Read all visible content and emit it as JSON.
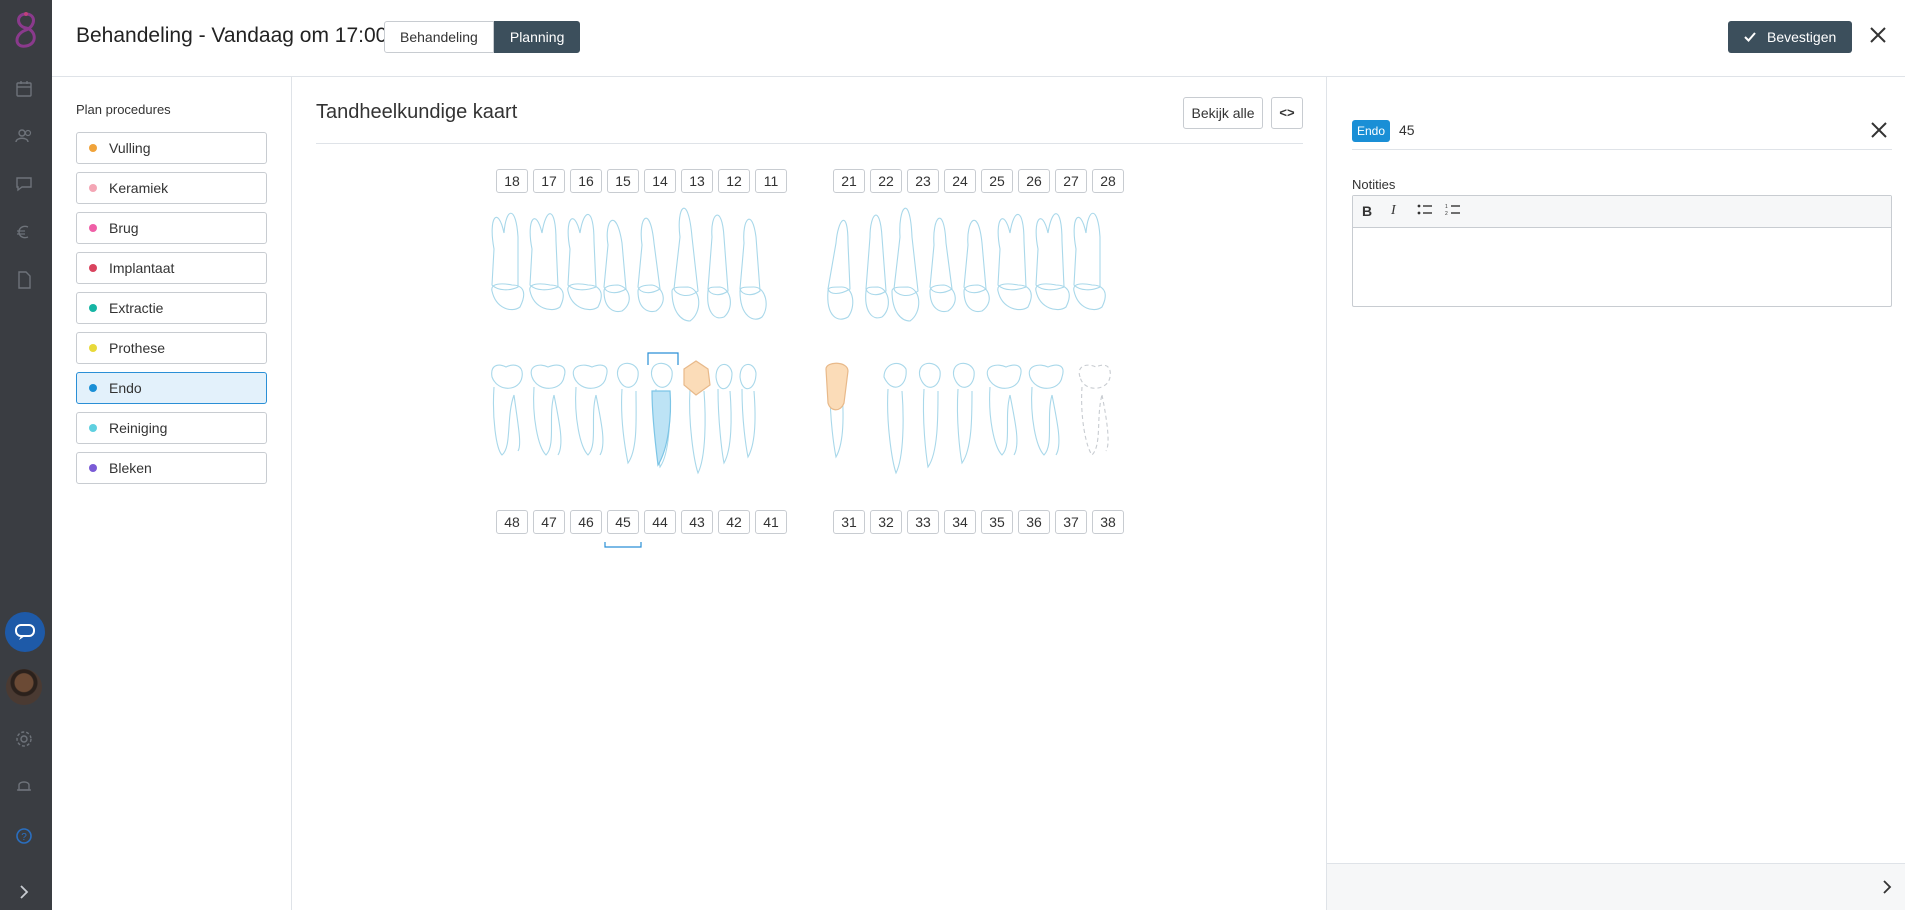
{
  "header": {
    "title": "Behandeling - Vandaag om 17:00",
    "tabs": [
      {
        "label": "Behandeling",
        "active": false
      },
      {
        "label": "Planning",
        "active": true
      }
    ],
    "confirm_label": "Bevestigen",
    "colors": {
      "accent_dark": "#3c4f5c",
      "accent_blue": "#1a8fd6"
    }
  },
  "sidebar": {
    "icons": [
      "logo-icon",
      "calendar-icon",
      "users-icon",
      "chat-icon",
      "euro-icon",
      "document-icon",
      "support-chat-icon",
      "avatar",
      "settings-icon",
      "bell-icon",
      "help-icon",
      "chevron-right-icon"
    ]
  },
  "procedures": {
    "title": "Plan procedures",
    "items": [
      {
        "label": "Vulling",
        "color": "#f0a33a"
      },
      {
        "label": "Keramiek",
        "color": "#f4a6b5"
      },
      {
        "label": "Brug",
        "color": "#ef5fa7"
      },
      {
        "label": "Implantaat",
        "color": "#d9435e"
      },
      {
        "label": "Extractie",
        "color": "#16b5a4"
      },
      {
        "label": "Prothese",
        "color": "#e8d93a"
      },
      {
        "label": "Endo",
        "color": "#1a8fd6",
        "selected": true
      },
      {
        "label": "Reiniging",
        "color": "#5fd0e0"
      },
      {
        "label": "Bleken",
        "color": "#7a5bd6"
      }
    ]
  },
  "dental_chart": {
    "title": "Tandheelkundige kaart",
    "view_all_label": "Bekijk alle",
    "code_toggle_label": "<>",
    "upper_numbers": [
      "18",
      "17",
      "16",
      "15",
      "14",
      "13",
      "12",
      "11",
      "21",
      "22",
      "23",
      "24",
      "25",
      "26",
      "27",
      "28"
    ],
    "lower_numbers": [
      "48",
      "47",
      "46",
      "45",
      "44",
      "43",
      "42",
      "41",
      "31",
      "32",
      "33",
      "34",
      "35",
      "36",
      "37",
      "38"
    ],
    "selected_tooth": "45"
  },
  "detail": {
    "badge": "Endo",
    "tooth": "45",
    "notes_label": "Notities",
    "notes_value": "",
    "toolbar": [
      "bold-icon",
      "italic-icon",
      "bullet-list-icon",
      "numbered-list-icon"
    ]
  }
}
